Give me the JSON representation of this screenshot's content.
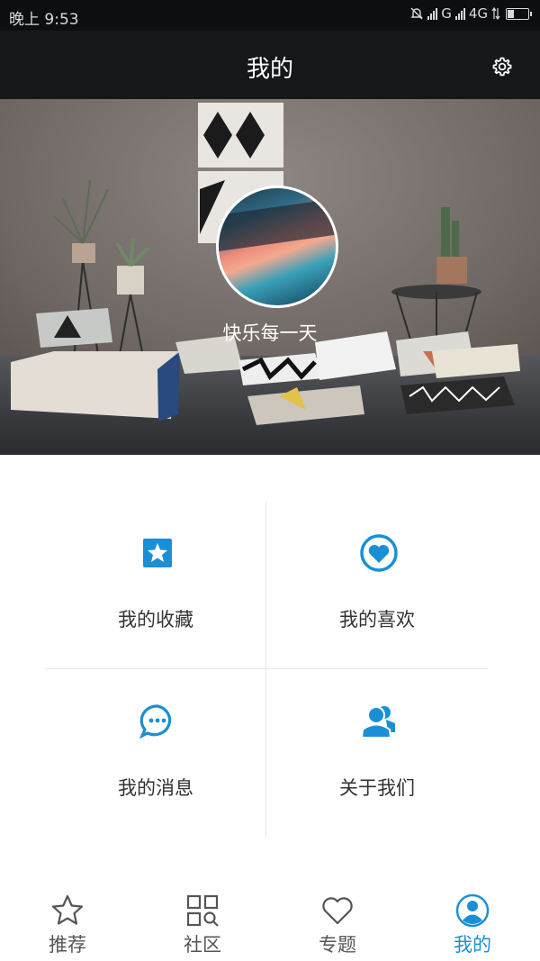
{
  "status_bar": {
    "time": "晚上 9:53",
    "network_g": "G",
    "network_4g": "4G",
    "battery_level": 0.35
  },
  "header": {
    "title": "我的"
  },
  "profile": {
    "nickname": "快乐每一天"
  },
  "menu": {
    "favorites": "我的收藏",
    "likes": "我的喜欢",
    "messages": "我的消息",
    "about": "关于我们"
  },
  "bottom_nav": {
    "items": [
      {
        "label": "推荐",
        "icon": "star-outline-icon"
      },
      {
        "label": "社区",
        "icon": "grid-search-icon"
      },
      {
        "label": "专题",
        "icon": "heart-outline-icon"
      },
      {
        "label": "我的",
        "icon": "person-circle-icon"
      }
    ],
    "active_index": 3
  },
  "colors": {
    "accent": "#1a8fd6",
    "header_bg": "#141819",
    "text": "#333333",
    "inactive": "#555555"
  }
}
